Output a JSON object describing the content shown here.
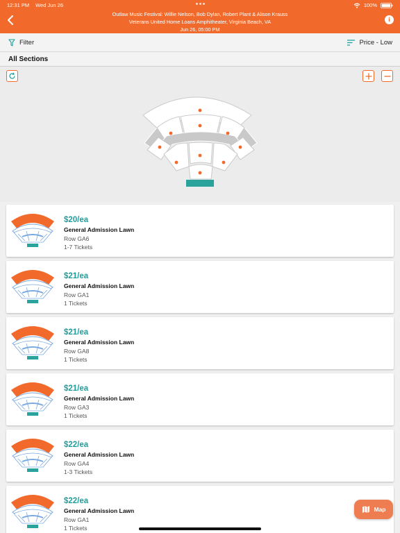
{
  "status": {
    "time": "12:31 PM",
    "date": "Wed Jun 26",
    "battery": "100%"
  },
  "event": {
    "line1": "Outlaw Music Festival: Willie Nelson, Bob Dylan, Robert Plant & Alison Krauss",
    "line2": "Veterans United Home Loans Amphitheater, Virginia Beach, VA",
    "line3": "Jun 26, 05:00 PM"
  },
  "toolbar": {
    "filter_label": "Filter",
    "sort_label": "Price - Low"
  },
  "section_title": "All Sections",
  "colors": {
    "brand": "#f26a2b",
    "price": "#1f9e9c",
    "stage": "#2aa39d",
    "seat_dot": "#f26a2b"
  },
  "listings": [
    {
      "price": "$20/ea",
      "section": "General Admission Lawn",
      "row": "Row GA6",
      "quantity": "1-7 Tickets"
    },
    {
      "price": "$21/ea",
      "section": "General Admission Lawn",
      "row": "Row GA1",
      "quantity": "1 Tickets"
    },
    {
      "price": "$21/ea",
      "section": "General Admission Lawn",
      "row": "Row GA8",
      "quantity": "1 Tickets"
    },
    {
      "price": "$21/ea",
      "section": "General Admission Lawn",
      "row": "Row GA3",
      "quantity": "1 Tickets"
    },
    {
      "price": "$22/ea",
      "section": "General Admission Lawn",
      "row": "Row GA4",
      "quantity": "1-3 Tickets"
    },
    {
      "price": "$22/ea",
      "section": "General Admission Lawn",
      "row": "Row GA1",
      "quantity": "1 Tickets"
    }
  ],
  "map_button_label": "Map"
}
